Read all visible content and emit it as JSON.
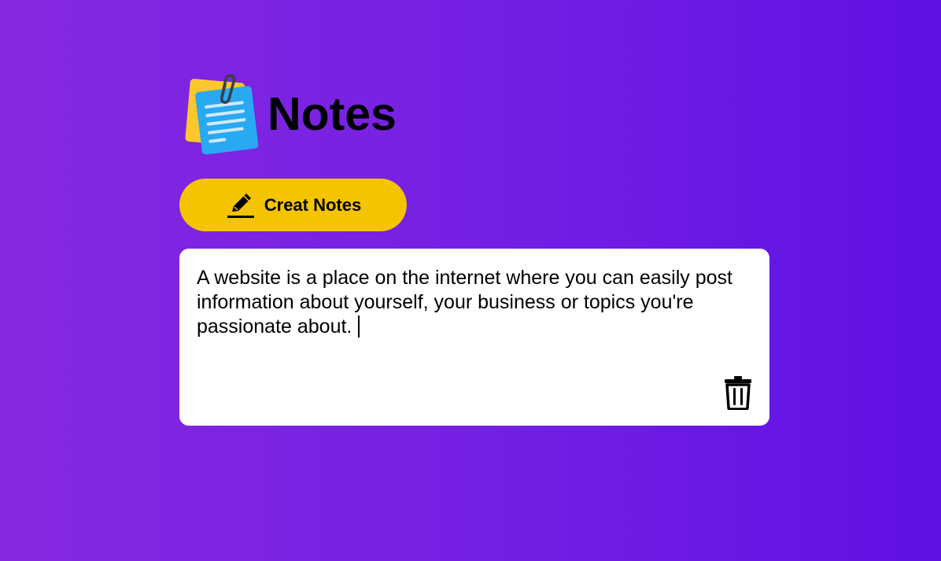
{
  "app": {
    "title": "Notes",
    "logo_icon": "sticky-notes-icon"
  },
  "toolbar": {
    "create_label": "Creat Notes",
    "create_icon": "pencil-icon"
  },
  "notes": [
    {
      "text": "A website is a place on the internet where you can easily post information about yourself, your business or topics you're passionate about.",
      "delete_icon": "trash-icon"
    }
  ],
  "colors": {
    "background_start": "#8528e0",
    "background_end": "#5f10e3",
    "button": "#f5c400",
    "note_background": "#ffffff"
  }
}
